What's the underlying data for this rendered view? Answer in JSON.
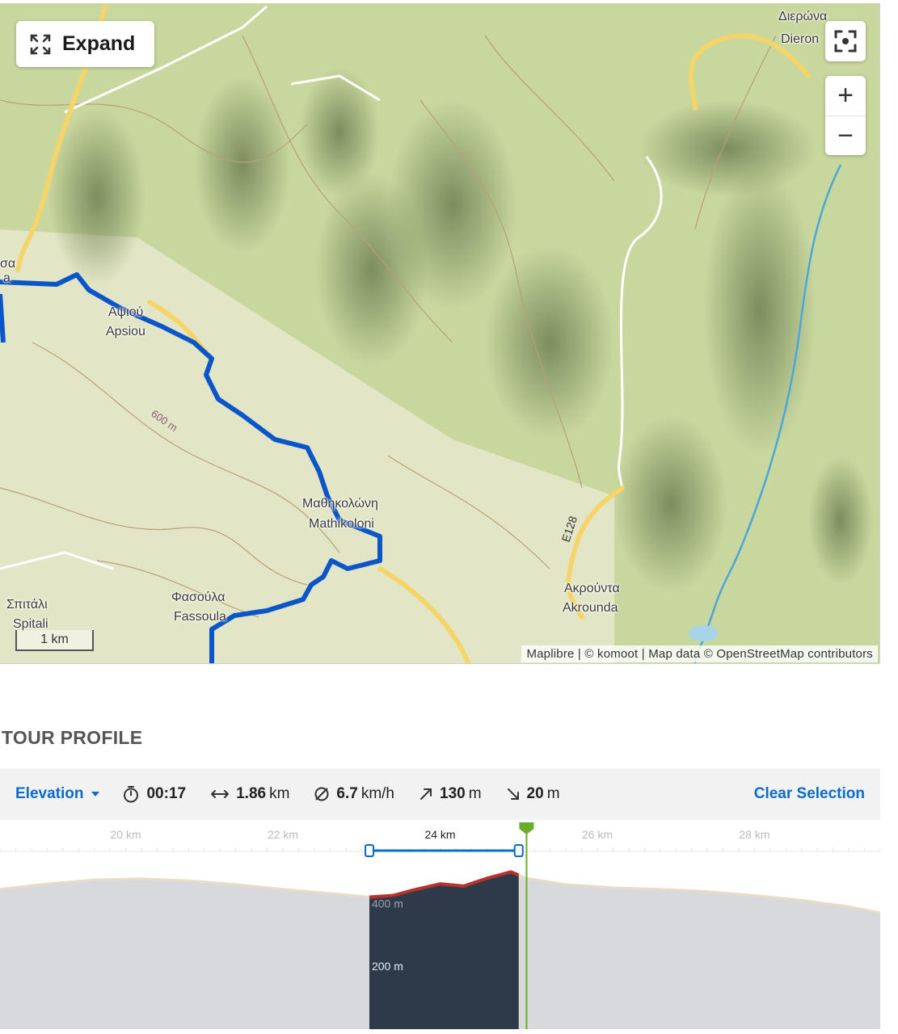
{
  "map": {
    "expand_label": "Expand",
    "zoom_in": "+",
    "zoom_out": "−",
    "attribution": "Maplibre | © komoot | Map data © OpenStreetMap contributors",
    "scale_label": "1 km",
    "contour_label": "600 m",
    "road_label": "E128",
    "places": [
      {
        "greek": "Διερώνα",
        "latin": "Dieron"
      },
      {
        "greek": "Αψιού",
        "latin": "Apsiou"
      },
      {
        "greek": "Μαθηκολώνη",
        "latin": "Mathikoloni"
      },
      {
        "greek": "Ακρούντα",
        "latin": "Akrounda"
      },
      {
        "greek": "Φασούλα",
        "latin": "Fassoula"
      },
      {
        "greek": "Σπιτάλι",
        "latin": "Spitali"
      },
      {
        "greek": "σα",
        "latin": "a"
      }
    ],
    "colors": {
      "route": "#0a55c9",
      "road_major": "#f7d774",
      "water": "#4aa7d8",
      "terrain": "#c9d8a2"
    }
  },
  "profile": {
    "title": "TOUR PROFILE",
    "selector_label": "Elevation",
    "duration": "00:17",
    "distance_value": "1.86",
    "distance_unit": "km",
    "speed_value": "6.7",
    "speed_unit": "km/h",
    "ascent_value": "130",
    "ascent_unit": "m",
    "descent_value": "20",
    "descent_unit": "m",
    "clear_selection": "Clear Selection"
  },
  "chart_data": {
    "type": "area",
    "x_unit": "km",
    "x_ticks": [
      20,
      22,
      24,
      26,
      28
    ],
    "x_tick_labels": [
      "20 km",
      "22 km",
      "24 km",
      "26 km",
      "28 km"
    ],
    "y_tick_labels": [
      "400 m",
      "200 m"
    ],
    "xlim": [
      18.4,
      29.6
    ],
    "ylim": [
      0,
      560
    ],
    "selection": [
      23.1,
      25.0
    ],
    "marker_x": 25.1,
    "x": [
      18.4,
      19.0,
      19.6,
      20.2,
      20.8,
      21.4,
      22.0,
      22.6,
      23.1,
      23.4,
      23.7,
      24.0,
      24.3,
      24.6,
      24.9,
      25.1,
      25.6,
      26.2,
      26.8,
      27.4,
      28.0,
      28.6,
      29.2,
      29.6
    ],
    "y": [
      445,
      462,
      475,
      478,
      472,
      460,
      445,
      432,
      420,
      425,
      445,
      462,
      455,
      480,
      500,
      480,
      460,
      450,
      445,
      438,
      425,
      410,
      390,
      370
    ],
    "colors": {
      "area": "#d8d9dc",
      "selection": "#2e3a4a",
      "marker": "#6aad2a",
      "range": "#0b6bcb"
    }
  }
}
